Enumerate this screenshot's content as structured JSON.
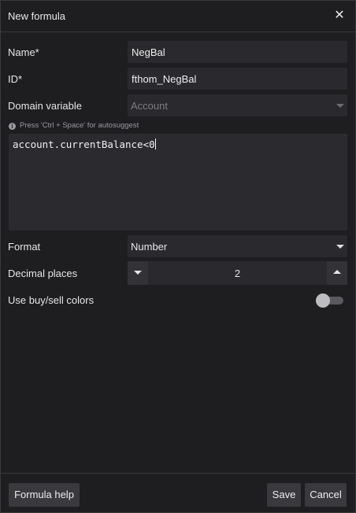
{
  "dialog": {
    "title": "New formula"
  },
  "form": {
    "name_label": "Name*",
    "name_value": "NegBal",
    "id_label": "ID*",
    "id_value": "fthom_NegBal",
    "domain_label": "Domain variable",
    "domain_value": "Account",
    "hint": "Press 'Ctrl + Space' for autosuggest",
    "expression": "account.currentBalance<0",
    "format_label": "Format",
    "format_value": "Number",
    "decimal_label": "Decimal places",
    "decimal_value": "2",
    "colors_label": "Use buy/sell colors",
    "colors_enabled": false
  },
  "footer": {
    "help_label": "Formula help",
    "save_label": "Save",
    "cancel_label": "Cancel"
  },
  "icons": {
    "close": "close-icon",
    "info": "info-icon",
    "caret": "chevron-down-icon"
  },
  "colors": {
    "background": "#1e1e21",
    "field": "#2a2a2e",
    "button": "#3a3a3e"
  }
}
